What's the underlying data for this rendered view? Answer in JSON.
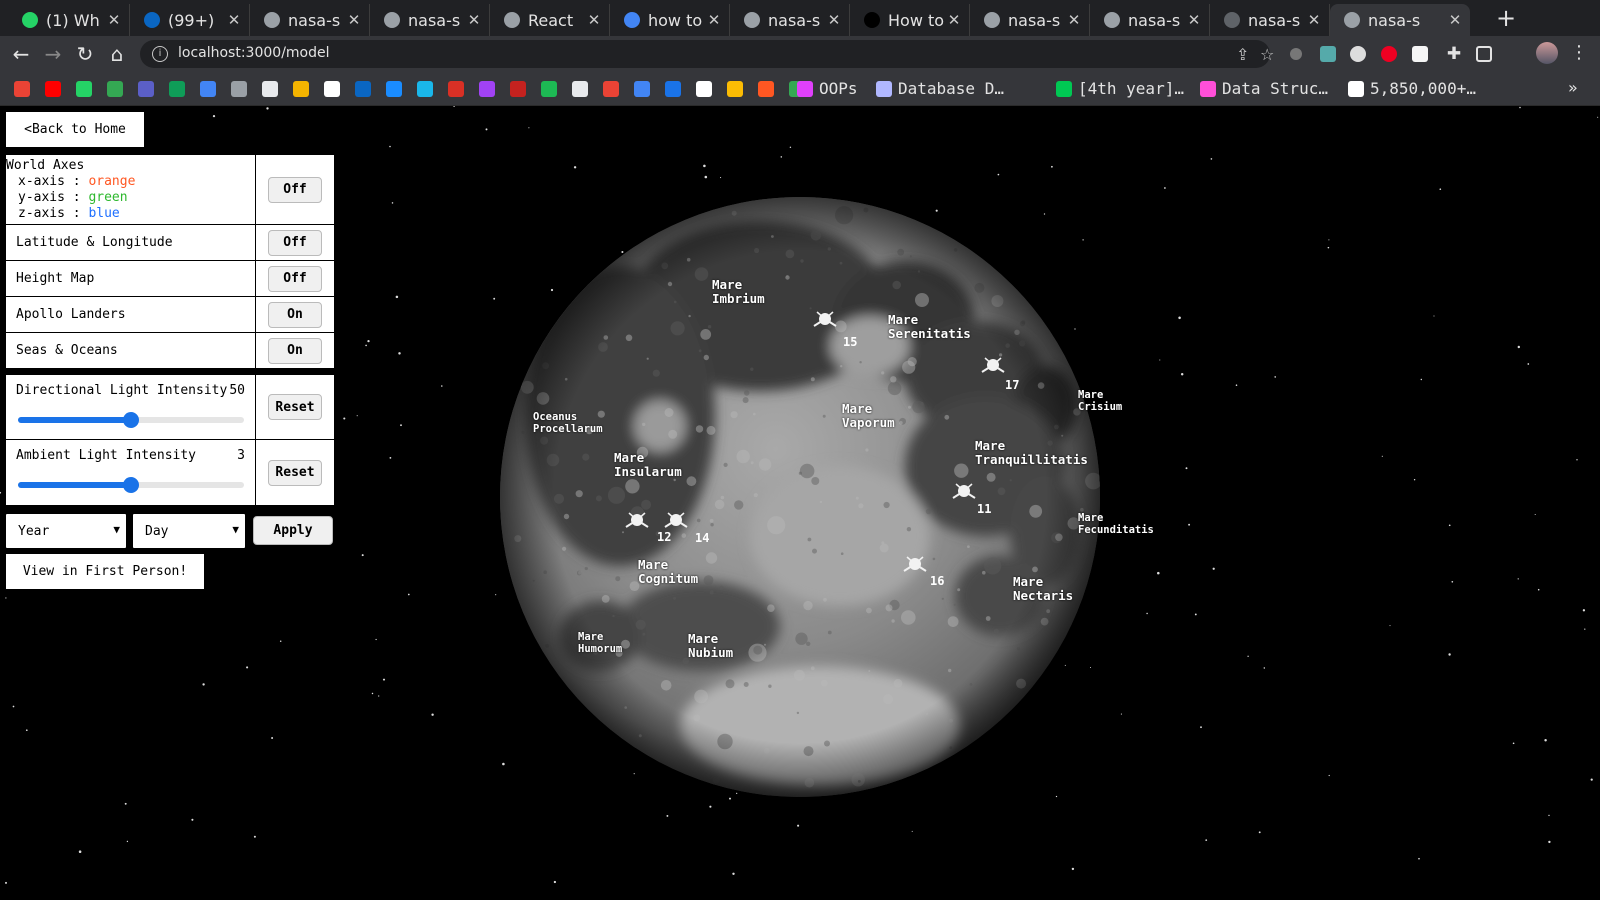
{
  "browser": {
    "tabs": [
      {
        "title": "(1) Wh",
        "favicon": "whatsapp-icon",
        "color": "#25d366"
      },
      {
        "title": "(99+)",
        "favicon": "linkedin-icon",
        "color": "#0a66c2"
      },
      {
        "title": "nasa-s",
        "favicon": "globe-icon",
        "color": "#9aa0a6"
      },
      {
        "title": "nasa-s",
        "favicon": "globe-icon",
        "color": "#9aa0a6"
      },
      {
        "title": "React",
        "favicon": "globe-icon",
        "color": "#9aa0a6"
      },
      {
        "title": "how to",
        "favicon": "google-icon",
        "color": "#4285f4"
      },
      {
        "title": "nasa-s",
        "favicon": "globe-icon",
        "color": "#9aa0a6"
      },
      {
        "title": "How to",
        "favicon": "medium-icon",
        "color": "#000000"
      },
      {
        "title": "nasa-s",
        "favicon": "globe-icon",
        "color": "#9aa0a6"
      },
      {
        "title": "nasa-s",
        "favicon": "globe-icon",
        "color": "#9aa0a6"
      },
      {
        "title": "nasa-s",
        "favicon": "github-icon",
        "color": "#5f6368"
      },
      {
        "title": "nasa-s",
        "favicon": "globe-icon",
        "color": "#9aa0a6",
        "active": true
      }
    ],
    "url": "localhost:3000/model",
    "bookmarks": [
      {
        "label": "OOPs",
        "icon": "oops-icon"
      },
      {
        "label": "Database D…",
        "icon": "database-icon"
      },
      {
        "label": "[4th year]…",
        "icon": "fourth-year-icon"
      },
      {
        "label": "Data Struc…",
        "icon": "data-struct-icon"
      },
      {
        "label": "5,850,000+…",
        "icon": "count-icon"
      }
    ]
  },
  "controls": {
    "back_home": "<Back to Home",
    "world_axes": {
      "label": "World Axes",
      "x_prefix": "x-axis : ",
      "x_color": "orange",
      "y_prefix": "y-axis : ",
      "y_color": "green",
      "z_prefix": "z-axis : ",
      "z_color": "blue",
      "state": "Off"
    },
    "lat_long": {
      "label": "Latitude & Longitude",
      "state": "Off"
    },
    "height_map": {
      "label": "Height Map",
      "state": "Off"
    },
    "apollo_landers": {
      "label": "Apollo Landers",
      "state": "On"
    },
    "seas_oceans": {
      "label": "Seas & Oceans",
      "state": "On"
    },
    "directional_light": {
      "label": "Directional Light Intensity",
      "value": "50",
      "fraction": 0.5,
      "reset": "Reset"
    },
    "ambient_light": {
      "label": "Ambient Light Intensity",
      "value": "3",
      "fraction": 0.5,
      "reset": "Reset"
    },
    "year_select": "Year",
    "day_select": "Day",
    "apply": "Apply",
    "first_person": "View in First Person!"
  },
  "moon": {
    "seas": [
      {
        "name": "Mare\nImbrium"
      },
      {
        "name": "Mare\nSerenitatis"
      },
      {
        "name": "Mare\nCrisium"
      },
      {
        "name": "Oceanus\nProcellarum"
      },
      {
        "name": "Mare\nVaporum"
      },
      {
        "name": "Mare\nTranquillitatis"
      },
      {
        "name": "Mare\nInsularum"
      },
      {
        "name": "Mare\nFecunditatis"
      },
      {
        "name": "Mare\nCognitum"
      },
      {
        "name": "Mare\nNectaris"
      },
      {
        "name": "Mare\nHumorum"
      },
      {
        "name": "Mare\nNubium"
      }
    ],
    "landers": [
      "15",
      "17",
      "11",
      "12",
      "14",
      "16"
    ]
  },
  "colors": {
    "axis_x": "#ff5722",
    "axis_y": "#2eb82e",
    "axis_z": "#1e6fff",
    "slider": "#1a73e8",
    "chrome_dark": "#202124",
    "chrome": "#35363a"
  }
}
